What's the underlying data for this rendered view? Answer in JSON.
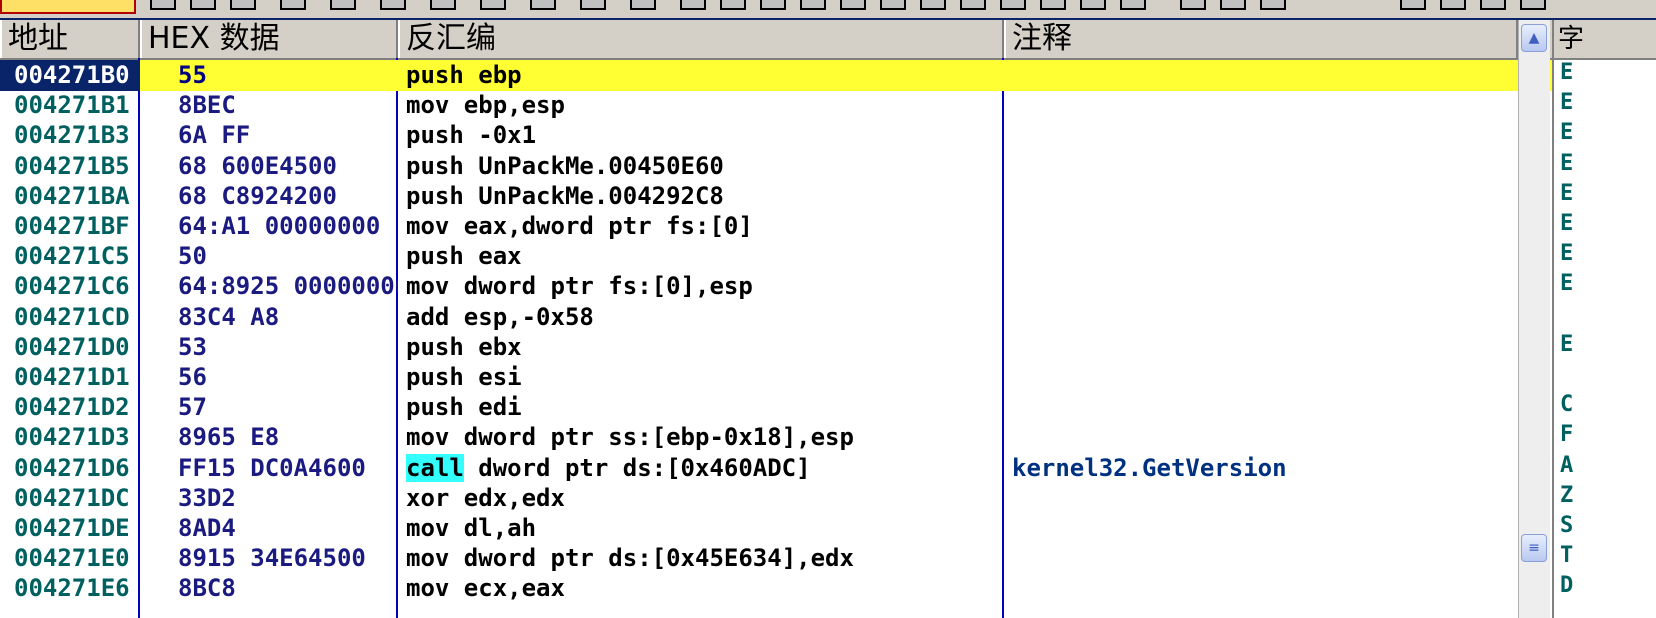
{
  "columns": {
    "address": "地址",
    "hex": "HEX 数据",
    "disassembly": "反汇编",
    "comment": "注释",
    "right": "字"
  },
  "rows": [
    {
      "addr": "004271B0",
      "hex": "55",
      "op": "push",
      "args": " ebp",
      "comment": "",
      "selected": true
    },
    {
      "addr": "004271B1",
      "hex": "8BEC",
      "op": "mov",
      "args": " ebp,esp",
      "comment": ""
    },
    {
      "addr": "004271B3",
      "hex": "6A FF",
      "op": "push",
      "args": " -0x1",
      "comment": ""
    },
    {
      "addr": "004271B5",
      "hex": "68 600E4500",
      "op": "push",
      "args": " UnPackMe.00450E60",
      "comment": ""
    },
    {
      "addr": "004271BA",
      "hex": "68 C8924200",
      "op": "push",
      "args": " UnPackMe.004292C8",
      "comment": ""
    },
    {
      "addr": "004271BF",
      "hex": "64:A1 00000000",
      "op": "mov",
      "args": " eax,dword ptr fs:[0]",
      "comment": ""
    },
    {
      "addr": "004271C5",
      "hex": "50",
      "op": "push",
      "args": " eax",
      "comment": ""
    },
    {
      "addr": "004271C6",
      "hex": "64:8925 00000000",
      "op": "mov",
      "args": " dword ptr fs:[0],esp",
      "comment": ""
    },
    {
      "addr": "004271CD",
      "hex": "83C4 A8",
      "op": "add",
      "args": " esp,-0x58",
      "comment": ""
    },
    {
      "addr": "004271D0",
      "hex": "53",
      "op": "push",
      "args": " ebx",
      "comment": ""
    },
    {
      "addr": "004271D1",
      "hex": "56",
      "op": "push",
      "args": " esi",
      "comment": ""
    },
    {
      "addr": "004271D2",
      "hex": "57",
      "op": "push",
      "args": " edi",
      "comment": ""
    },
    {
      "addr": "004271D3",
      "hex": "8965 E8",
      "op": "mov",
      "args": " dword ptr ss:[ebp-0x18],esp",
      "comment": ""
    },
    {
      "addr": "004271D6",
      "hex": "FF15 DC0A4600",
      "op": "call",
      "args": " dword ptr ds:[0x460ADC]",
      "comment": "kernel32.GetVersion",
      "highlight_op": true
    },
    {
      "addr": "004271DC",
      "hex": "33D2",
      "op": "xor",
      "args": " edx,edx",
      "comment": ""
    },
    {
      "addr": "004271DE",
      "hex": "8AD4",
      "op": "mov",
      "args": " dl,ah",
      "comment": ""
    },
    {
      "addr": "004271E0",
      "hex": "8915 34E64500",
      "op": "mov",
      "args": " dword ptr ds:[0x45E634],edx",
      "comment": ""
    },
    {
      "addr": "004271E6",
      "hex": "8BC8",
      "op": "mov",
      "args": " ecx,eax",
      "comment": ""
    }
  ],
  "right_panel_chars": [
    "E",
    "E",
    "E",
    "E",
    "E",
    "E",
    "E",
    "E",
    "",
    "E",
    "",
    "C",
    "F",
    "A",
    "Z",
    "S",
    "T",
    "D"
  ],
  "colors": {
    "selected_row": "#ffff33",
    "selected_address_bg": "#0a246a",
    "call_highlight": "#33ffff",
    "column_divider": "#0000c0"
  },
  "icons": {
    "scroll_up": "▲",
    "scroll_thumb": "≡"
  }
}
